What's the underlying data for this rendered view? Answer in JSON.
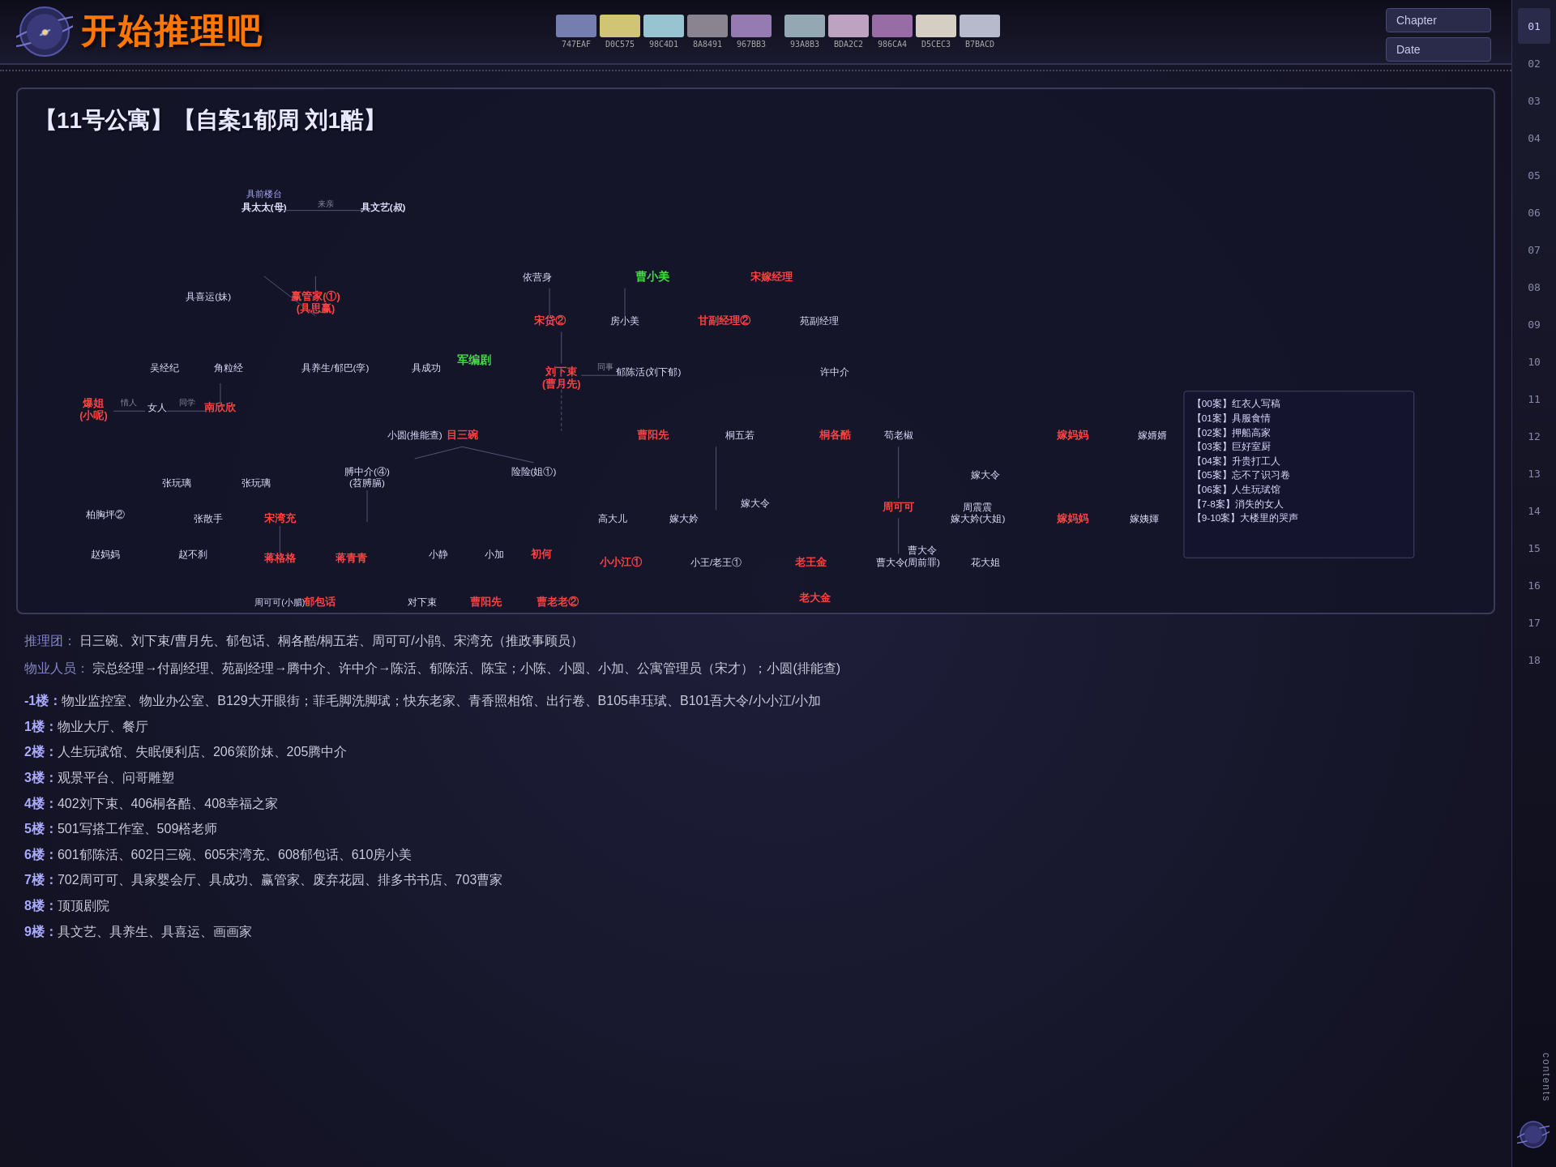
{
  "header": {
    "logo_alt": "开始推理吧",
    "title": "开始推理吧"
  },
  "palette": {
    "group1": [
      {
        "color": "#747EAF",
        "label": "747EAF"
      },
      {
        "color": "#D0C575",
        "label": "D0C575"
      },
      {
        "color": "#98C4D1",
        "label": "98C4D1"
      },
      {
        "color": "#8A8491",
        "label": "8A8491"
      },
      {
        "color": "#967BB3",
        "label": "967BB3"
      }
    ],
    "group2": [
      {
        "color": "#93A8B3",
        "label": "93A8B3"
      },
      {
        "color": "#BDA2C2",
        "label": "BDA2C2"
      },
      {
        "color": "#986CA4",
        "label": "986CA4"
      },
      {
        "color": "#D5CEC3",
        "label": "D5CEC3"
      },
      {
        "color": "#B7BACD",
        "label": "B7BACD"
      }
    ]
  },
  "chapter_label": "Chapter",
  "date_label": "Date",
  "nav_numbers": [
    "01",
    "02",
    "03",
    "04",
    "05",
    "06",
    "07",
    "08",
    "09",
    "10",
    "11",
    "12",
    "13",
    "14",
    "15",
    "16",
    "17",
    "18"
  ],
  "nav_contents_label": "contents",
  "panel_title": "【11号公寓】【自案1郁周  刘1酷】",
  "diagram_note": "Character relationship diagram",
  "info": {
    "reasoning_team_label": "推理团：",
    "reasoning_team": "日三碗、刘下束/曹月先、郁包话、桐各酷/桐五若、周可可/小鹃、宋湾充（推政事顾员）",
    "property_staff_label": "物业人员：",
    "property_staff": "宗总经理→付副经理、苑副经理→腾中介、许中介→陈活、郁陈活、陈宝；小陈、小圆、小加、公寓管理员（宋才）；小圆(排能查)"
  },
  "floors": [
    {
      "num": "-1楼：",
      "content": "物业监控室、物业办公室、B129大开眼街；菲毛脚洗脚珷；快东老家、青香照相馆、出行卷、B105串珏珷、B101吾大令/小小江/小加"
    },
    {
      "num": "1楼：",
      "content": "物业大厅、餐厅"
    },
    {
      "num": "2楼：",
      "content": "人生玩珷馆、失眠便利店、206策阶妹、205腾中介"
    },
    {
      "num": "3楼：",
      "content": "观景平台、问哥雕塑"
    },
    {
      "num": "4楼：",
      "content": "402刘下束、406桐各酷、408幸福之家"
    },
    {
      "num": "5楼：",
      "content": "501写搭工作室、509榙老师"
    },
    {
      "num": "6楼：",
      "content": "601郁陈活、602日三碗、605宋湾充、608郁包话、610房小美"
    },
    {
      "num": "7楼：",
      "content": "702周可可、具家婴会厅、具成功、赢管家、废弃花园、排多书书店、703曹家"
    },
    {
      "num": "8楼：",
      "content": "顶顶剧院"
    },
    {
      "num": "9楼：",
      "content": "具文艺、具养生、具喜运、画画家"
    }
  ],
  "sidebar_chapters": [
    "【00案】红衣人写稿",
    "【01案】具服食情",
    "【02案】押船高家",
    "【03案】巨好室厨",
    "【04案】升贵打工人",
    "【05案】忘不了识习卷",
    "【06案】人生玩珷馆",
    "【7-8案】消失的女人",
    "【9-10案】大楼里的哭声"
  ]
}
